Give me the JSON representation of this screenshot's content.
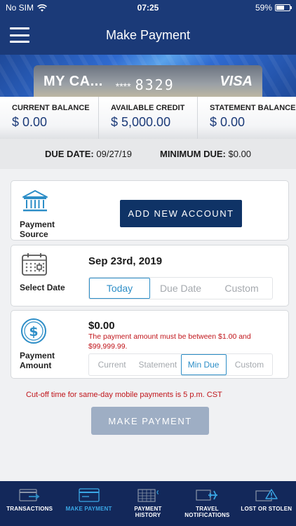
{
  "status": {
    "carrier": "No SIM",
    "time": "07:25",
    "battery": "59%",
    "battery_level": 0.59
  },
  "header": {
    "title": "Make Payment"
  },
  "card": {
    "name": "MY CA...",
    "mask": "****",
    "last4": "8329",
    "network": "VISA"
  },
  "balances": [
    {
      "label": "CURRENT BALANCE",
      "value": "$ 0.00"
    },
    {
      "label": "AVAILABLE CREDIT",
      "value": "$ 5,000.00"
    },
    {
      "label": "STATEMENT BALANCE",
      "value": "$ 0.00"
    }
  ],
  "due": {
    "due_label": "DUE DATE:",
    "due_value": "09/27/19",
    "min_label": "MINIMUM DUE:",
    "min_value": "$0.00"
  },
  "source": {
    "label_line1": "Payment",
    "label_line2": "Source",
    "button": "ADD NEW ACCOUNT"
  },
  "date": {
    "label": "Select Date",
    "value": "Sep 23rd, 2019",
    "options": [
      "Today",
      "Due Date",
      "Custom"
    ],
    "selected": "Today"
  },
  "amount": {
    "label_line1": "Payment",
    "label_line2": "Amount",
    "value": "$0.00",
    "error": "The payment amount must be between $1.00 and $99,999.99.",
    "options": [
      "Current",
      "Statement",
      "Min Due",
      "Custom"
    ],
    "selected": "Min Due"
  },
  "cutoff": "Cut-off time for same-day mobile payments is 5 p.m. CST",
  "make_payment_button": "MAKE PAYMENT",
  "tabs": [
    {
      "label_line1": "TRANSACTIONS",
      "label_line2": "",
      "icon": "card-arrow-icon"
    },
    {
      "label_line1": "MAKE PAYMENT",
      "label_line2": "",
      "icon": "card-icon",
      "active": true
    },
    {
      "label_line1": "PAYMENT",
      "label_line2": "HISTORY",
      "icon": "calendar-icon"
    },
    {
      "label_line1": "TRAVEL",
      "label_line2": "NOTIFICATIONS",
      "icon": "plane-icon"
    },
    {
      "label_line1": "LOST OR STOLEN",
      "label_line2": "",
      "icon": "warning-icon"
    }
  ],
  "colors": {
    "header": "#1b3a78",
    "primary_button": "#0f3366",
    "accent": "#2d8ec7",
    "error": "#c0141a",
    "tabbar": "#13285a",
    "tab_active": "#3aa7e6"
  }
}
